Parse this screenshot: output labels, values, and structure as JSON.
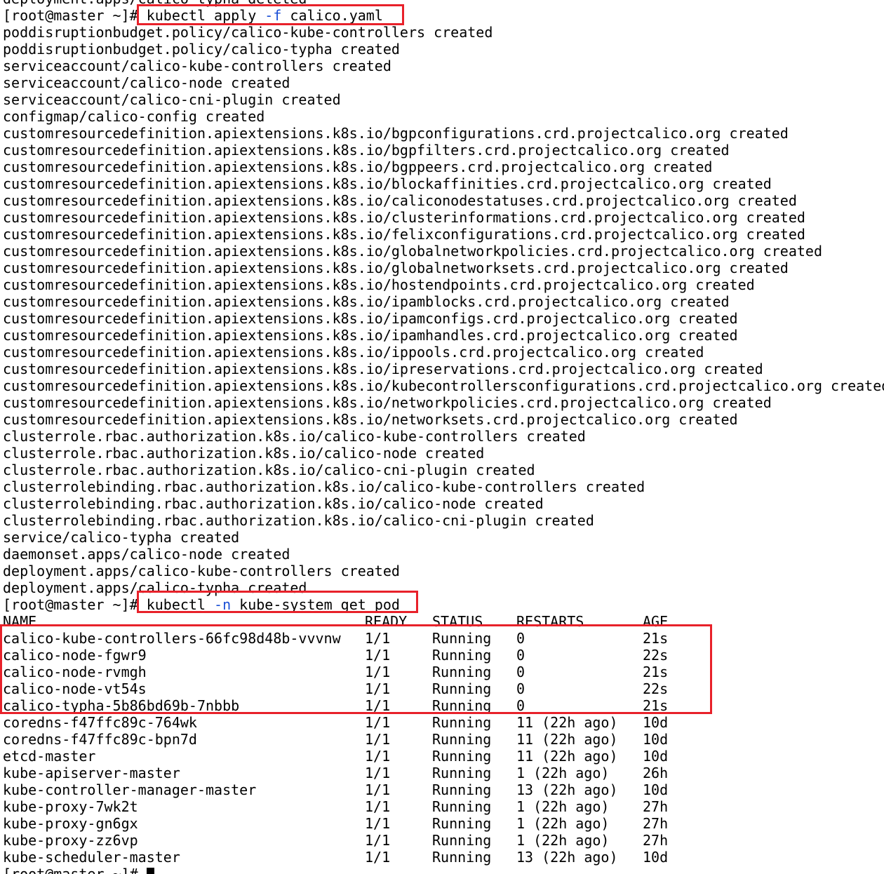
{
  "top_partial": "deployment.apps/calico-typha deleted",
  "prompt": "[root@master ~]#",
  "cmd1": {
    "prefix": "kubectl apply ",
    "flag": "-f",
    "suffix": " calico.yaml"
  },
  "apply_output": [
    "poddisruptionbudget.policy/calico-kube-controllers created",
    "poddisruptionbudget.policy/calico-typha created",
    "serviceaccount/calico-kube-controllers created",
    "serviceaccount/calico-node created",
    "serviceaccount/calico-cni-plugin created",
    "configmap/calico-config created",
    "customresourcedefinition.apiextensions.k8s.io/bgpconfigurations.crd.projectcalico.org created",
    "customresourcedefinition.apiextensions.k8s.io/bgpfilters.crd.projectcalico.org created",
    "customresourcedefinition.apiextensions.k8s.io/bgppeers.crd.projectcalico.org created",
    "customresourcedefinition.apiextensions.k8s.io/blockaffinities.crd.projectcalico.org created",
    "customresourcedefinition.apiextensions.k8s.io/caliconodestatuses.crd.projectcalico.org created",
    "customresourcedefinition.apiextensions.k8s.io/clusterinformations.crd.projectcalico.org created",
    "customresourcedefinition.apiextensions.k8s.io/felixconfigurations.crd.projectcalico.org created",
    "customresourcedefinition.apiextensions.k8s.io/globalnetworkpolicies.crd.projectcalico.org created",
    "customresourcedefinition.apiextensions.k8s.io/globalnetworksets.crd.projectcalico.org created",
    "customresourcedefinition.apiextensions.k8s.io/hostendpoints.crd.projectcalico.org created",
    "customresourcedefinition.apiextensions.k8s.io/ipamblocks.crd.projectcalico.org created",
    "customresourcedefinition.apiextensions.k8s.io/ipamconfigs.crd.projectcalico.org created",
    "customresourcedefinition.apiextensions.k8s.io/ipamhandles.crd.projectcalico.org created",
    "customresourcedefinition.apiextensions.k8s.io/ippools.crd.projectcalico.org created",
    "customresourcedefinition.apiextensions.k8s.io/ipreservations.crd.projectcalico.org created",
    "customresourcedefinition.apiextensions.k8s.io/kubecontrollersconfigurations.crd.projectcalico.org created",
    "customresourcedefinition.apiextensions.k8s.io/networkpolicies.crd.projectcalico.org created",
    "customresourcedefinition.apiextensions.k8s.io/networksets.crd.projectcalico.org created",
    "clusterrole.rbac.authorization.k8s.io/calico-kube-controllers created",
    "clusterrole.rbac.authorization.k8s.io/calico-node created",
    "clusterrole.rbac.authorization.k8s.io/calico-cni-plugin created",
    "clusterrolebinding.rbac.authorization.k8s.io/calico-kube-controllers created",
    "clusterrolebinding.rbac.authorization.k8s.io/calico-node created",
    "clusterrolebinding.rbac.authorization.k8s.io/calico-cni-plugin created",
    "service/calico-typha created",
    "daemonset.apps/calico-node created",
    "deployment.apps/calico-kube-controllers created",
    "deployment.apps/calico-typha created"
  ],
  "cmd2": {
    "prefix": "kubectl ",
    "flag": "-n",
    "suffix": " kube-system get pod"
  },
  "pod_table": {
    "headers": [
      "NAME",
      "READY",
      "STATUS",
      "RESTARTS",
      "AGE"
    ],
    "rows": [
      [
        "calico-kube-controllers-66fc98d48b-vvvnw",
        "1/1",
        "Running",
        "0",
        "21s"
      ],
      [
        "calico-node-fgwr9",
        "1/1",
        "Running",
        "0",
        "22s"
      ],
      [
        "calico-node-rvmgh",
        "1/1",
        "Running",
        "0",
        "21s"
      ],
      [
        "calico-node-vt54s",
        "1/1",
        "Running",
        "0",
        "22s"
      ],
      [
        "calico-typha-5b86bd69b-7nbbb",
        "1/1",
        "Running",
        "0",
        "21s"
      ],
      [
        "coredns-f47ffc89c-764wk",
        "1/1",
        "Running",
        "11 (22h ago)",
        "10d"
      ],
      [
        "coredns-f47ffc89c-bpn7d",
        "1/1",
        "Running",
        "11 (22h ago)",
        "10d"
      ],
      [
        "etcd-master",
        "1/1",
        "Running",
        "11 (22h ago)",
        "10d"
      ],
      [
        "kube-apiserver-master",
        "1/1",
        "Running",
        "1 (22h ago)",
        "26h"
      ],
      [
        "kube-controller-manager-master",
        "1/1",
        "Running",
        "13 (22h ago)",
        "10d"
      ],
      [
        "kube-proxy-7wk2t",
        "1/1",
        "Running",
        "1 (22h ago)",
        "27h"
      ],
      [
        "kube-proxy-gn6gx",
        "1/1",
        "Running",
        "1 (22h ago)",
        "27h"
      ],
      [
        "kube-proxy-zz6vp",
        "1/1",
        "Running",
        "1 (22h ago)",
        "27h"
      ],
      [
        "kube-scheduler-master",
        "1/1",
        "Running",
        "13 (22h ago)",
        "10d"
      ]
    ]
  },
  "colors": {
    "highlight": "#e8212a",
    "flag": "#1a4fd6",
    "text": "#000000",
    "background": "#ffffff"
  }
}
